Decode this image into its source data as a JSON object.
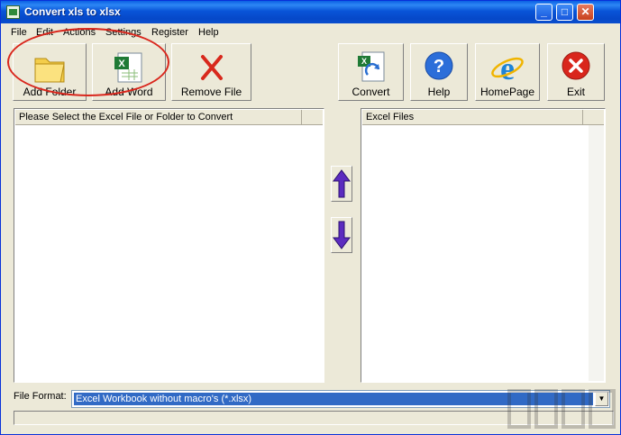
{
  "window": {
    "title": "Convert xls to xlsx",
    "controls": [
      "minimize-icon",
      "maximize-icon",
      "close-icon"
    ]
  },
  "menu": [
    "File",
    "Edit",
    "Actions",
    "Settings",
    "Register",
    "Help"
  ],
  "toolbar": {
    "left": [
      {
        "label": "Add Folder",
        "icon": "folder-icon"
      },
      {
        "label": "Add Word",
        "icon": "excel-file-icon"
      },
      {
        "label": "Remove File",
        "icon": "red-x-icon"
      }
    ],
    "right": [
      {
        "label": "Convert",
        "icon": "convert-icon"
      },
      {
        "label": "Help",
        "icon": "help-icon"
      },
      {
        "label": "HomePage",
        "icon": "internet-explorer-icon"
      },
      {
        "label": "Exit",
        "icon": "exit-icon"
      }
    ]
  },
  "source_panel": {
    "header": "Please Select the Excel File or Folder to Convert",
    "rows": []
  },
  "target_panel": {
    "header": "Excel Files",
    "rows": []
  },
  "move_buttons": [
    "move-up-icon",
    "move-down-icon"
  ],
  "file_format": {
    "label": "File Format:",
    "selected": "Excel Workbook without macro's (*.xlsx)"
  },
  "status": ""
}
